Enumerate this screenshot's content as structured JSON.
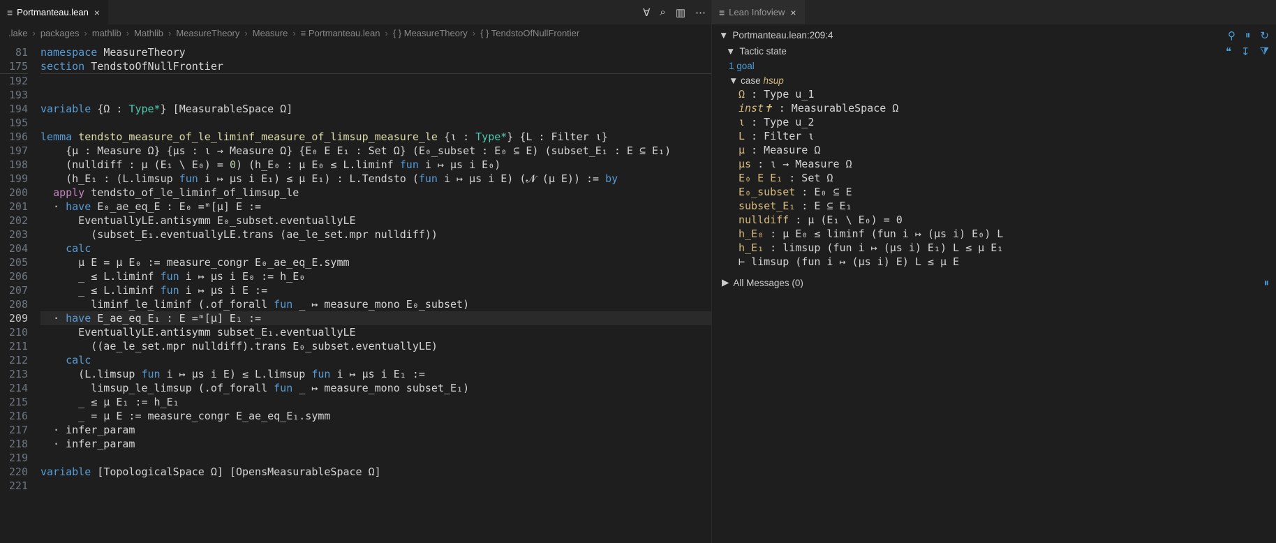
{
  "editor": {
    "tab": {
      "title": "Portmanteau.lean",
      "icon": "≡"
    },
    "actions": {
      "forall": "∀",
      "search": "⌕",
      "split": "▥",
      "more": "⋯"
    },
    "breadcrumb": [
      ".lake",
      "packages",
      "mathlib",
      "Mathlib",
      "MeasureTheory",
      "Measure",
      "≡ Portmanteau.lean",
      "{ } MeasureTheory",
      "{ } TendstoOfNullFrontier"
    ],
    "sticky": [
      {
        "ln": "81",
        "t": [
          [
            "kw",
            "namespace "
          ],
          [
            "nsname",
            "MeasureTheory"
          ]
        ]
      },
      {
        "ln": "175",
        "t": [
          [
            "kw",
            "section "
          ],
          [
            "nsname",
            "TendstoOfNullFrontier"
          ]
        ]
      }
    ],
    "lines": [
      {
        "ln": "192",
        "t": []
      },
      {
        "ln": "193",
        "t": []
      },
      {
        "ln": "194",
        "t": [
          [
            "kw",
            "variable "
          ],
          [
            "op",
            "{Ω "
          ],
          [
            "op",
            ": "
          ],
          [
            "ty",
            "Type*"
          ],
          [
            "op",
            "} ["
          ],
          [
            "nsname",
            "MeasurableSpace Ω"
          ],
          [
            "op",
            "]"
          ]
        ]
      },
      {
        "ln": "195",
        "t": []
      },
      {
        "ln": "196",
        "t": [
          [
            "kw",
            "lemma "
          ],
          [
            "fn",
            "tendsto_measure_of_le_liminf_measure_of_limsup_measure_le "
          ],
          [
            "op",
            "{ι "
          ],
          [
            "op",
            ": "
          ],
          [
            "ty",
            "Type*"
          ],
          [
            "op",
            "} {L : "
          ],
          [
            "nsname",
            "Filter ι"
          ],
          [
            "op",
            "}"
          ]
        ]
      },
      {
        "ln": "197",
        "t": [
          [
            "op",
            "    {μ : "
          ],
          [
            "nsname",
            "Measure Ω"
          ],
          [
            "op",
            "} {μs : ι → "
          ],
          [
            "nsname",
            "Measure Ω"
          ],
          [
            "op",
            "} {E₀ E E₁ : "
          ],
          [
            "nsname",
            "Set Ω"
          ],
          [
            "op",
            "} (E₀_subset : E₀ ⊆ E) (subset_E₁ : E ⊆ E₁)"
          ]
        ]
      },
      {
        "ln": "198",
        "t": [
          [
            "op",
            "    (nulldiff : μ (E₁ \\ E₀) = "
          ],
          [
            "num",
            "0"
          ],
          [
            "op",
            ") (h_E₀ : μ E₀ ≤ L.liminf "
          ],
          [
            "kw",
            "fun "
          ],
          [
            "op",
            "i ↦ μs i E₀)"
          ]
        ]
      },
      {
        "ln": "199",
        "t": [
          [
            "op",
            "    (h_E₁ : (L.limsup "
          ],
          [
            "kw",
            "fun "
          ],
          [
            "op",
            "i ↦ μs i E₁) ≤ μ E₁) : L.Tendsto ("
          ],
          [
            "kw",
            "fun "
          ],
          [
            "op",
            "i ↦ μs i E) (𝓝 (μ E)) := "
          ],
          [
            "kw",
            "by"
          ]
        ]
      },
      {
        "ln": "200",
        "t": [
          [
            "op",
            "  "
          ],
          [
            "tac",
            "apply "
          ],
          [
            "nsname",
            "tendsto_of_le_liminf_of_limsup_le"
          ]
        ]
      },
      {
        "ln": "201",
        "t": [
          [
            "op",
            "  · "
          ],
          [
            "kw",
            "have "
          ],
          [
            "nsname",
            "E₀_ae_eq_E"
          ],
          [
            "op",
            " : E₀ =ᵐ[μ] E :="
          ]
        ]
      },
      {
        "ln": "202",
        "t": [
          [
            "op",
            "      EventuallyLE.antisymm E₀_subset.eventuallyLE"
          ]
        ]
      },
      {
        "ln": "203",
        "t": [
          [
            "op",
            "        (subset_E₁.eventuallyLE.trans (ae_le_set.mpr nulldiff))"
          ]
        ]
      },
      {
        "ln": "204",
        "t": [
          [
            "op",
            "    "
          ],
          [
            "kw",
            "calc"
          ]
        ]
      },
      {
        "ln": "205",
        "t": [
          [
            "op",
            "      μ E = μ E₀ := measure_congr E₀_ae_eq_E.symm"
          ]
        ]
      },
      {
        "ln": "206",
        "t": [
          [
            "op",
            "      _ ≤ L.liminf "
          ],
          [
            "kw",
            "fun "
          ],
          [
            "op",
            "i ↦ μs i E₀ := h_E₀"
          ]
        ]
      },
      {
        "ln": "207",
        "t": [
          [
            "op",
            "      _ ≤ L.liminf "
          ],
          [
            "kw",
            "fun "
          ],
          [
            "op",
            "i ↦ μs i E :="
          ]
        ]
      },
      {
        "ln": "208",
        "t": [
          [
            "op",
            "        liminf_le_liminf (.of_forall "
          ],
          [
            "kw",
            "fun "
          ],
          [
            "op",
            "_ ↦ measure_mono E₀_subset)"
          ]
        ]
      },
      {
        "ln": "209",
        "cur": true,
        "t": [
          [
            "op",
            "  · "
          ],
          [
            "kw",
            "have "
          ],
          [
            "nsname",
            "E_ae_eq_E₁"
          ],
          [
            "op",
            " : E =ᵐ[μ] E₁ :="
          ]
        ]
      },
      {
        "ln": "210",
        "t": [
          [
            "op",
            "      EventuallyLE.antisymm subset_E₁.eventuallyLE"
          ]
        ]
      },
      {
        "ln": "211",
        "t": [
          [
            "op",
            "        ((ae_le_set.mpr nulldiff).trans E₀_subset.eventuallyLE)"
          ]
        ]
      },
      {
        "ln": "212",
        "t": [
          [
            "op",
            "    "
          ],
          [
            "kw",
            "calc"
          ]
        ]
      },
      {
        "ln": "213",
        "t": [
          [
            "op",
            "      (L.limsup "
          ],
          [
            "kw",
            "fun "
          ],
          [
            "op",
            "i ↦ μs i E) ≤ L.limsup "
          ],
          [
            "kw",
            "fun "
          ],
          [
            "op",
            "i ↦ μs i E₁ :="
          ]
        ]
      },
      {
        "ln": "214",
        "t": [
          [
            "op",
            "        limsup_le_limsup (.of_forall "
          ],
          [
            "kw",
            "fun "
          ],
          [
            "op",
            "_ ↦ measure_mono subset_E₁)"
          ]
        ]
      },
      {
        "ln": "215",
        "t": [
          [
            "op",
            "      _ ≤ μ E₁ := h_E₁"
          ]
        ]
      },
      {
        "ln": "216",
        "t": [
          [
            "op",
            "      _ = μ E := measure_congr E_ae_eq_E₁.symm"
          ]
        ]
      },
      {
        "ln": "217",
        "t": [
          [
            "op",
            "  · "
          ],
          [
            "nsname",
            "infer_param"
          ]
        ]
      },
      {
        "ln": "218",
        "t": [
          [
            "op",
            "  · "
          ],
          [
            "nsname",
            "infer_param"
          ]
        ]
      },
      {
        "ln": "219",
        "t": []
      },
      {
        "ln": "220",
        "t": [
          [
            "kw",
            "variable "
          ],
          [
            "op",
            "["
          ],
          [
            "nsname",
            "TopologicalSpace Ω"
          ],
          [
            "op",
            "] ["
          ],
          [
            "nsname",
            "OpensMeasurableSpace Ω"
          ],
          [
            "op",
            "]"
          ]
        ]
      },
      {
        "ln": "221",
        "t": []
      }
    ]
  },
  "infoview": {
    "tab": {
      "title": "Lean Infoview",
      "icon": "≡"
    },
    "location": "Portmanteau.lean:209:4",
    "topActions": {
      "pin": "⚲",
      "pause": "⏸",
      "refresh": "↻"
    },
    "tacticHeader": "Tactic state",
    "tacticActions": {
      "quote": "❝",
      "down": "↧",
      "filter": "⧩"
    },
    "goalCount": "1 goal",
    "caseLabel": "case",
    "caseName": "hsup",
    "hyps": [
      [
        [
          "hypname",
          "Ω"
        ],
        [
          "op",
          " : "
        ],
        [
          "op",
          "Type u_1"
        ]
      ],
      [
        [
          "hyp-it",
          "inst✝"
        ],
        [
          "op",
          " : MeasurableSpace Ω"
        ]
      ],
      [
        [
          "hypname",
          "ι"
        ],
        [
          "op",
          " : Type u_2"
        ]
      ],
      [
        [
          "hypname",
          "L"
        ],
        [
          "op",
          " : Filter ι"
        ]
      ],
      [
        [
          "hypname",
          "μ"
        ],
        [
          "op",
          " : Measure Ω"
        ]
      ],
      [
        [
          "hypname",
          "μs"
        ],
        [
          "op",
          " : ι → Measure Ω"
        ]
      ],
      [
        [
          "hypname",
          "E₀ E E₁"
        ],
        [
          "op",
          " : Set Ω"
        ]
      ],
      [
        [
          "hypname",
          "E₀_subset"
        ],
        [
          "op",
          " : E₀ ⊆ E"
        ]
      ],
      [
        [
          "hypname",
          "subset_E₁"
        ],
        [
          "op",
          " : E ⊆ E₁"
        ]
      ],
      [
        [
          "hypname",
          "nulldiff"
        ],
        [
          "op",
          " : μ (E₁ \\ E₀) = 0"
        ]
      ],
      [
        [
          "hypname",
          "h_E₀"
        ],
        [
          "op",
          " : μ E₀ ≤ liminf (fun i ↦ (μs i) E₀) L"
        ]
      ],
      [
        [
          "hypname",
          "h_E₁"
        ],
        [
          "op",
          " : limsup (fun i ↦ (μs i) E₁) L ≤ μ E₁"
        ]
      ],
      [
        [
          "op",
          "⊢ limsup (fun i ↦ (μs i) E) L ≤ μ E"
        ]
      ]
    ],
    "allMessages": "All Messages (0)",
    "msgAction": "⏸"
  }
}
